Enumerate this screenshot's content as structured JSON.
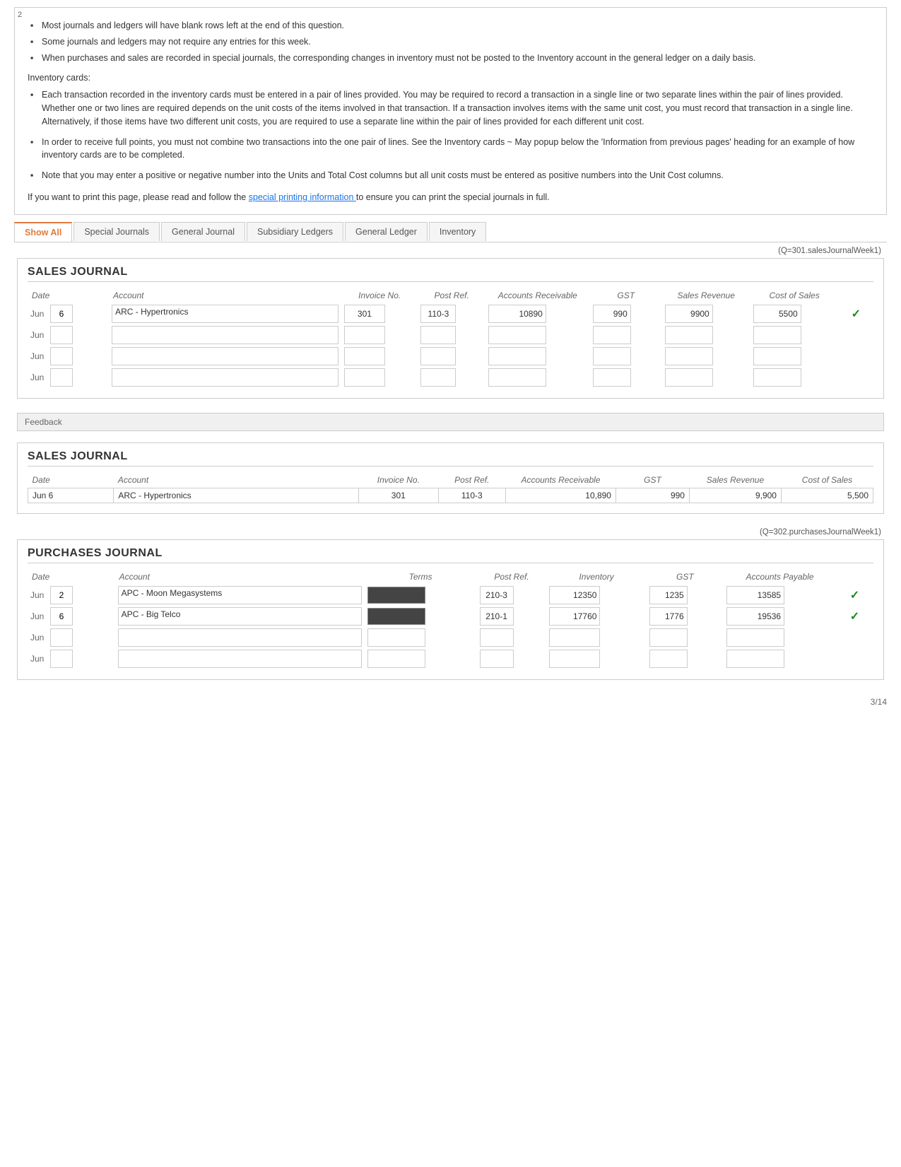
{
  "page": {
    "num": "2",
    "page_footer": "3/14"
  },
  "instructions": {
    "bullets": [
      "Most journals and ledgers will have blank rows left at the end of this question.",
      "Some journals and ledgers may not require any entries for this week.",
      "When purchases and sales are recorded in special journals, the corresponding changes in inventory must not be posted to the Inventory account in the general ledger on a daily basis."
    ],
    "inventory_label": "Inventory cards:",
    "inventory_bullets": [
      "Each transaction recorded in the inventory cards must be entered in a pair of lines provided. You may be required to record a transaction in a single line or two separate lines within the pair of lines provided. Whether one or two lines are required depends on the unit costs of the items involved in that transaction. If a transaction involves items with the same unit cost, you must record that transaction in a single line. Alternatively, if those items have two different unit costs, you are required to use a separate line within the pair of lines provided for each different unit cost.",
      "In order to receive full points, you must not combine two transactions into the one pair of lines. See the Inventory cards ~ May popup below the 'Information from previous pages' heading for an example of how inventory cards are to be completed.",
      "Note that you may enter a positive or negative number into the Units and Total Cost columns but all unit costs must be entered as positive numbers into the Unit Cost columns."
    ],
    "print_note_prefix": "If you want to print this page, please read and follow the ",
    "print_note_link": "special printing information ",
    "print_note_suffix": "to ensure you can print the special journals in full."
  },
  "tabs": {
    "show_all": "Show All",
    "special_journals": "Special Journals",
    "general_journal": "General Journal",
    "subsidiary_ledgers": "Subsidiary Ledgers",
    "general_ledger": "General Ledger",
    "inventory": "Inventory"
  },
  "sales_journal": {
    "title": "SALES JOURNAL",
    "ref": "(Q=301.salesJournalWeek1)",
    "headers": {
      "date": "Date",
      "account": "Account",
      "invoice_no": "Invoice No.",
      "post_ref": "Post Ref.",
      "accounts_receivable": "Accounts Receivable",
      "gst": "GST",
      "sales_revenue": "Sales Revenue",
      "cost_of_sales": "Cost of Sales"
    },
    "rows": [
      {
        "month": "Jun",
        "day": "6",
        "account": "ARC - Hypertronics",
        "invoice_no": "301",
        "post_ref": "110-3",
        "accounts_receivable": "10890",
        "gst": "990",
        "sales_revenue": "9900",
        "cost_of_sales": "5500",
        "checked": true
      },
      {
        "month": "Jun",
        "day": "",
        "account": "",
        "invoice_no": "",
        "post_ref": "",
        "accounts_receivable": "",
        "gst": "",
        "sales_revenue": "",
        "cost_of_sales": "",
        "checked": false
      },
      {
        "month": "Jun",
        "day": "",
        "account": "",
        "invoice_no": "",
        "post_ref": "",
        "accounts_receivable": "",
        "gst": "",
        "sales_revenue": "",
        "cost_of_sales": "",
        "checked": false
      },
      {
        "month": "Jun",
        "day": "",
        "account": "",
        "invoice_no": "",
        "post_ref": "",
        "accounts_receivable": "",
        "gst": "",
        "sales_revenue": "",
        "cost_of_sales": "",
        "checked": false
      }
    ]
  },
  "feedback": {
    "label": "Feedback"
  },
  "sales_journal_answer": {
    "title": "SALES JOURNAL",
    "headers": {
      "date": "Date",
      "account": "Account",
      "invoice_no": "Invoice No.",
      "post_ref": "Post Ref.",
      "accounts_receivable": "Accounts Receivable",
      "gst": "GST",
      "sales_revenue": "Sales Revenue",
      "cost_of_sales": "Cost of Sales"
    },
    "rows": [
      {
        "month": "Jun",
        "day": "6",
        "account": "ARC - Hypertronics",
        "invoice_no": "301",
        "post_ref": "110-3",
        "accounts_receivable": "10,890",
        "gst": "990",
        "sales_revenue": "9,900",
        "cost_of_sales": "5,500"
      }
    ]
  },
  "purchases_journal": {
    "title": "PURCHASES JOURNAL",
    "ref": "(Q=302.purchasesJournalWeek1)",
    "headers": {
      "date": "Date",
      "account": "Account",
      "terms": "Terms",
      "post_ref": "Post Ref.",
      "inventory": "Inventory",
      "gst": "GST",
      "accounts_payable": "Accounts Payable"
    },
    "rows": [
      {
        "month": "Jun",
        "day": "2",
        "account": "APC - Moon Megasystems",
        "post_ref": "210-3",
        "inventory": "12350",
        "gst": "1235",
        "accounts_payable": "13585",
        "checked": true
      },
      {
        "month": "Jun",
        "day": "6",
        "account": "APC - Big Telco",
        "post_ref": "210-1",
        "inventory": "17760",
        "gst": "1776",
        "accounts_payable": "19536",
        "checked": true
      },
      {
        "month": "Jun",
        "day": "",
        "account": "",
        "post_ref": "",
        "inventory": "",
        "gst": "",
        "accounts_payable": "",
        "checked": false
      },
      {
        "month": "Jun",
        "day": "",
        "account": "",
        "post_ref": "",
        "inventory": "",
        "gst": "",
        "accounts_payable": "",
        "checked": false
      }
    ]
  }
}
